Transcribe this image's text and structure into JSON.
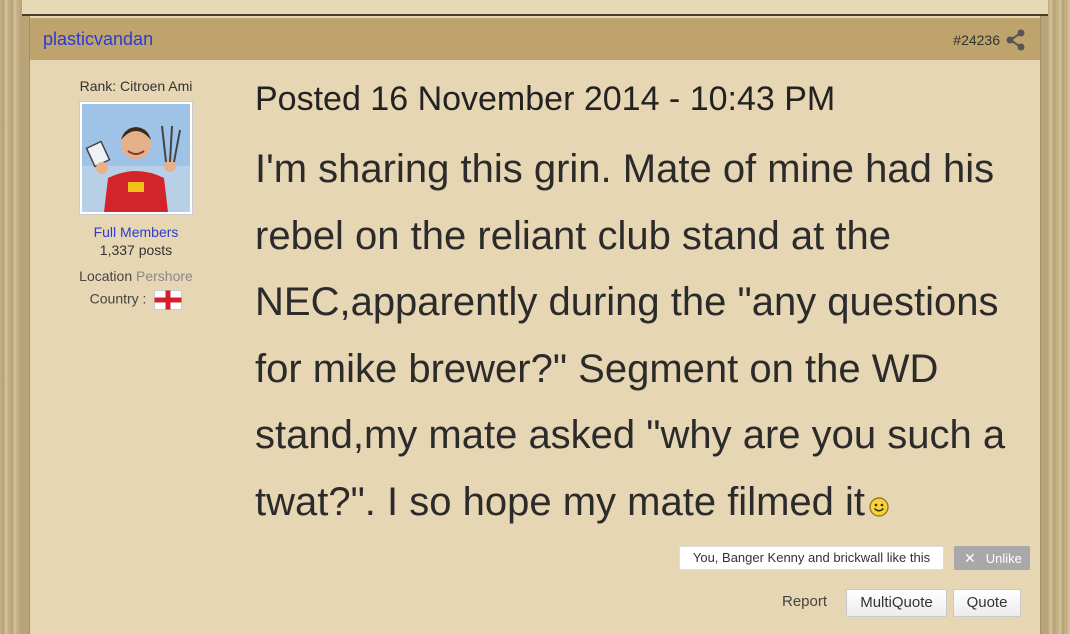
{
  "post": {
    "username": "plasticvandan",
    "post_number": "#24236",
    "date": "Posted 16 November 2014 - 10:43 PM",
    "body": "I'm sharing this grin. Mate of mine had his rebel on the reliant club stand at the NEC,apparently during the \"any questions for mike brewer?\" Segment on the WD stand,my mate asked \"why are you such a twat?\". I so hope my mate filmed it"
  },
  "author": {
    "rank": "Rank: Citroen Ami",
    "group": "Full Members",
    "posts": "1,337 posts",
    "location_label": "Location",
    "location_value": "Pershore",
    "country_label": "Country :",
    "country_flag": "england-flag-icon"
  },
  "reactions": {
    "likes_text": "You, Banger Kenny and brickwall like this",
    "unlike_label": "Unlike"
  },
  "actions": {
    "report": "Report",
    "multiquote": "MultiQuote",
    "quote": "Quote"
  },
  "colors": {
    "post_bg": "#e7d6b3",
    "header_bg": "#bfa36c",
    "link": "#2a3bd1"
  }
}
